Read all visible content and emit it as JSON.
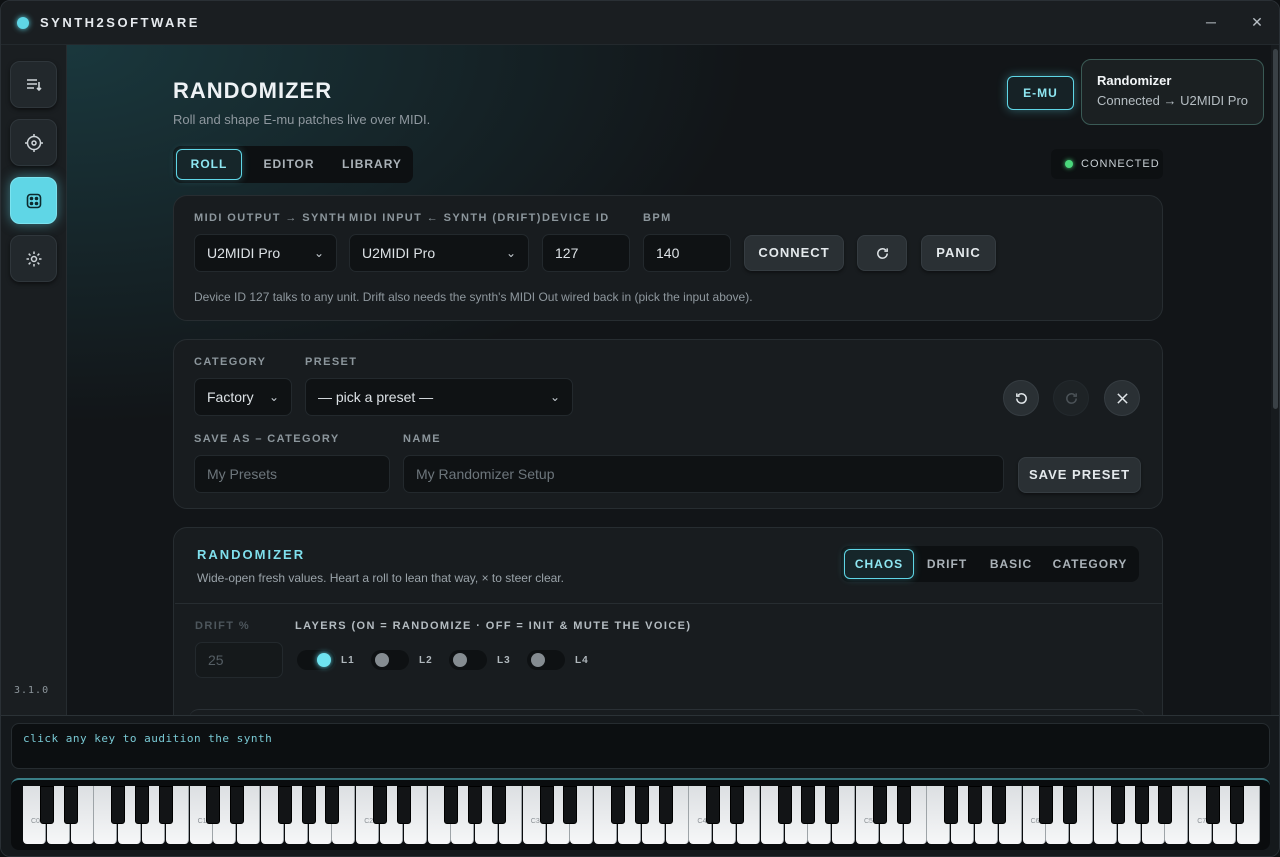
{
  "app": {
    "title": "SYNTH2SOFTWARE",
    "version": "3.1.0",
    "minimize": "─",
    "close": "✕"
  },
  "header": {
    "title": "RANDOMIZER",
    "subtitle": "Roll and shape E-mu patches live over MIDI.",
    "brand_button": "E-MU"
  },
  "toast": {
    "title": "Randomizer",
    "message": "Connected → U2MIDI Pro"
  },
  "tabs": [
    "ROLL",
    "EDITOR",
    "LIBRARY"
  ],
  "status": {
    "label": "CONNECTED",
    "color": "#4ad87c"
  },
  "midi": {
    "output_label": "MIDI OUTPUT → SYNTH",
    "output_value": "U2MIDI Pro",
    "input_label": "MIDI INPUT ← SYNTH (DRIFT)",
    "input_value": "U2MIDI Pro",
    "device_id_label": "DEVICE ID",
    "device_id": "127",
    "bpm_label": "BPM",
    "bpm": "140",
    "connect": "CONNECT",
    "panic": "PANIC",
    "help": "Device ID 127 talks to any unit. Drift also needs the synth's MIDI Out wired back in (pick the input above)."
  },
  "preset": {
    "category_label": "CATEGORY",
    "category_value": "Factory",
    "preset_label": "PRESET",
    "preset_value": "— pick a preset —",
    "save_category_label": "SAVE AS – CATEGORY",
    "save_category_placeholder": "My Presets",
    "name_label": "NAME",
    "name_placeholder": "My Randomizer Setup",
    "save": "SAVE PRESET"
  },
  "randomizer": {
    "title": "RANDOMIZER",
    "desc": "Wide-open fresh values. Heart a roll to lean that way, × to steer clear.",
    "modes": [
      "CHAOS",
      "DRIFT",
      "BASIC",
      "CATEGORY"
    ],
    "drift_label": "DRIFT %",
    "drift_value": "25",
    "layers_label": "LAYERS (ON = RANDOMIZE · OFF = INIT & MUTE THE VOICE)",
    "layers": [
      {
        "label": "L1",
        "on": true
      },
      {
        "label": "L2",
        "on": false
      },
      {
        "label": "L3",
        "on": false
      },
      {
        "label": "L4",
        "on": false
      }
    ]
  },
  "console": {
    "text": "click any key to audition the synth"
  },
  "keyboard": {
    "octave_labels": [
      "C0",
      "C1",
      "C2",
      "C3",
      "C4",
      "C5",
      "C6",
      "C7"
    ],
    "accent": "#5fd6e6"
  }
}
